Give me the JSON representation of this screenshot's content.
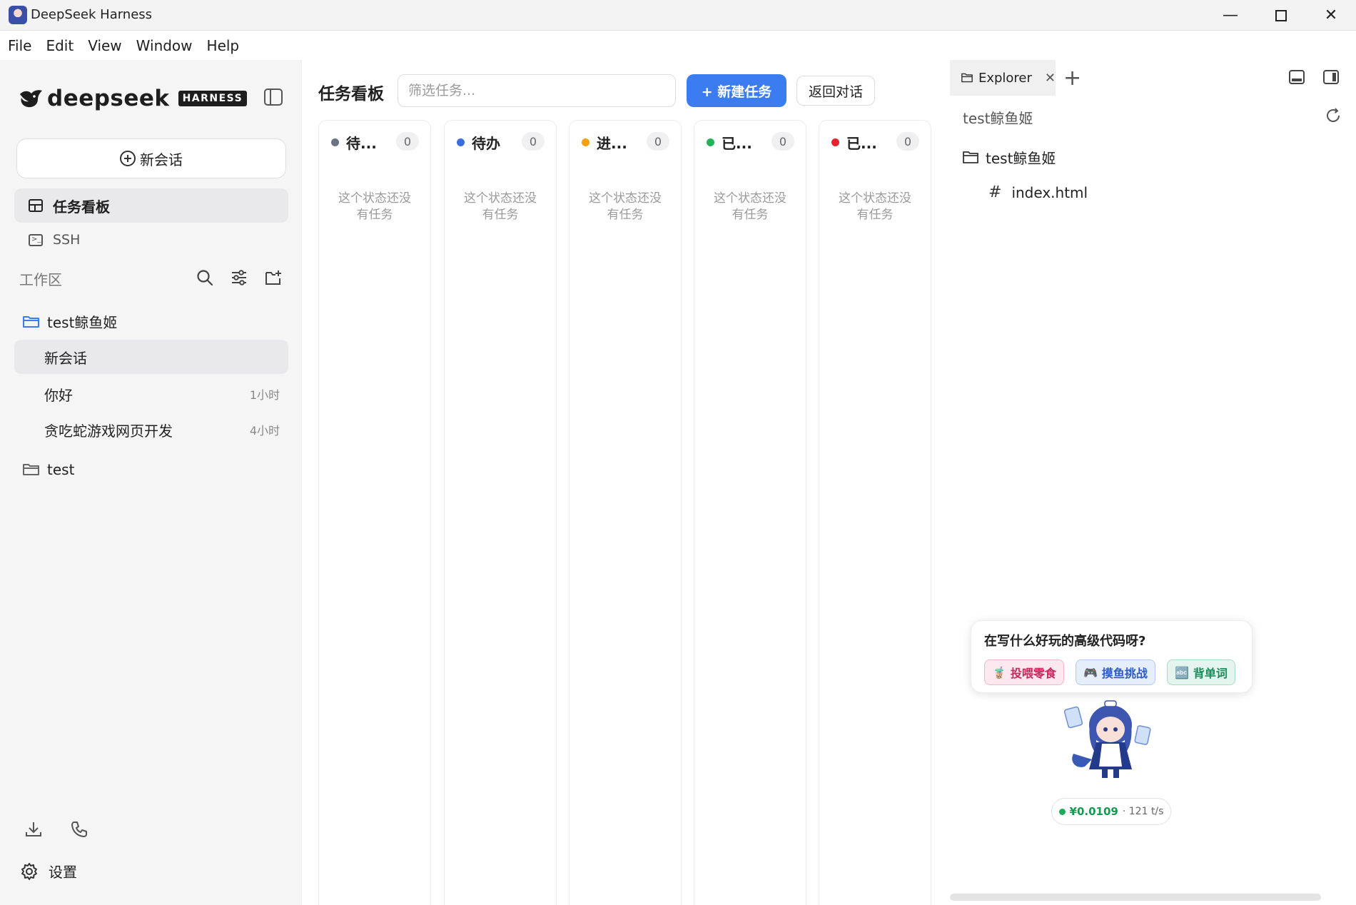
{
  "window": {
    "title": "DeepSeek Harness",
    "minimize": "—",
    "close": "✕"
  },
  "menu": [
    "File",
    "Edit",
    "View",
    "Window",
    "Help"
  ],
  "sidebar": {
    "brand_text": "deepseek",
    "brand_badge": "HARNESS",
    "new_chat": "新会话",
    "nav": [
      {
        "label": "任务看板",
        "active": true
      },
      {
        "label": "SSH",
        "active": false
      }
    ],
    "workspace_label": "工作区",
    "folders": [
      {
        "name": "test鲸鱼姬",
        "sessions": [
          {
            "title": "新会话",
            "time": "",
            "active": true
          },
          {
            "title": "你好",
            "time": "1小时",
            "active": false
          },
          {
            "title": "贪吃蛇游戏网页开发",
            "time": "4小时",
            "active": false
          }
        ]
      },
      {
        "name": "test",
        "sessions": []
      }
    ],
    "settings": "设置"
  },
  "board": {
    "title": "任务看板",
    "filter_placeholder": "筛选任务...",
    "new_task": "+ 新建任务",
    "back": "返回对话",
    "columns": [
      {
        "name": "待...",
        "count": "0",
        "color": "#6b7280",
        "empty": "这个状态还没有任务"
      },
      {
        "name": "待办",
        "count": "0",
        "color": "#3b6fe0",
        "empty": "这个状态还没有任务"
      },
      {
        "name": "进...",
        "count": "0",
        "color": "#f5a00f",
        "empty": "这个状态还没有任务"
      },
      {
        "name": "已...",
        "count": "0",
        "color": "#22b358",
        "empty": "这个状态还没有任务"
      },
      {
        "name": "已...",
        "count": "0",
        "color": "#e8222a",
        "empty": "这个状态还没有任务"
      }
    ]
  },
  "explorer": {
    "tab": "Explorer",
    "tab_close": "✕",
    "tab_add": "+",
    "root": "test鲸鱼姬",
    "folder": "test鲸鱼姬",
    "file_icon": "#",
    "file": "index.html"
  },
  "mascot": {
    "bubble_text": "在写什么好玩的高级代码呀?",
    "chips": [
      {
        "label": "投喂零食",
        "icon": "🧋"
      },
      {
        "label": "摸鱼挑战",
        "icon": "🎮"
      },
      {
        "label": "背单词",
        "icon": "🔤"
      }
    ],
    "cost": "¥0.0109",
    "rate": "· 121 t/s"
  }
}
